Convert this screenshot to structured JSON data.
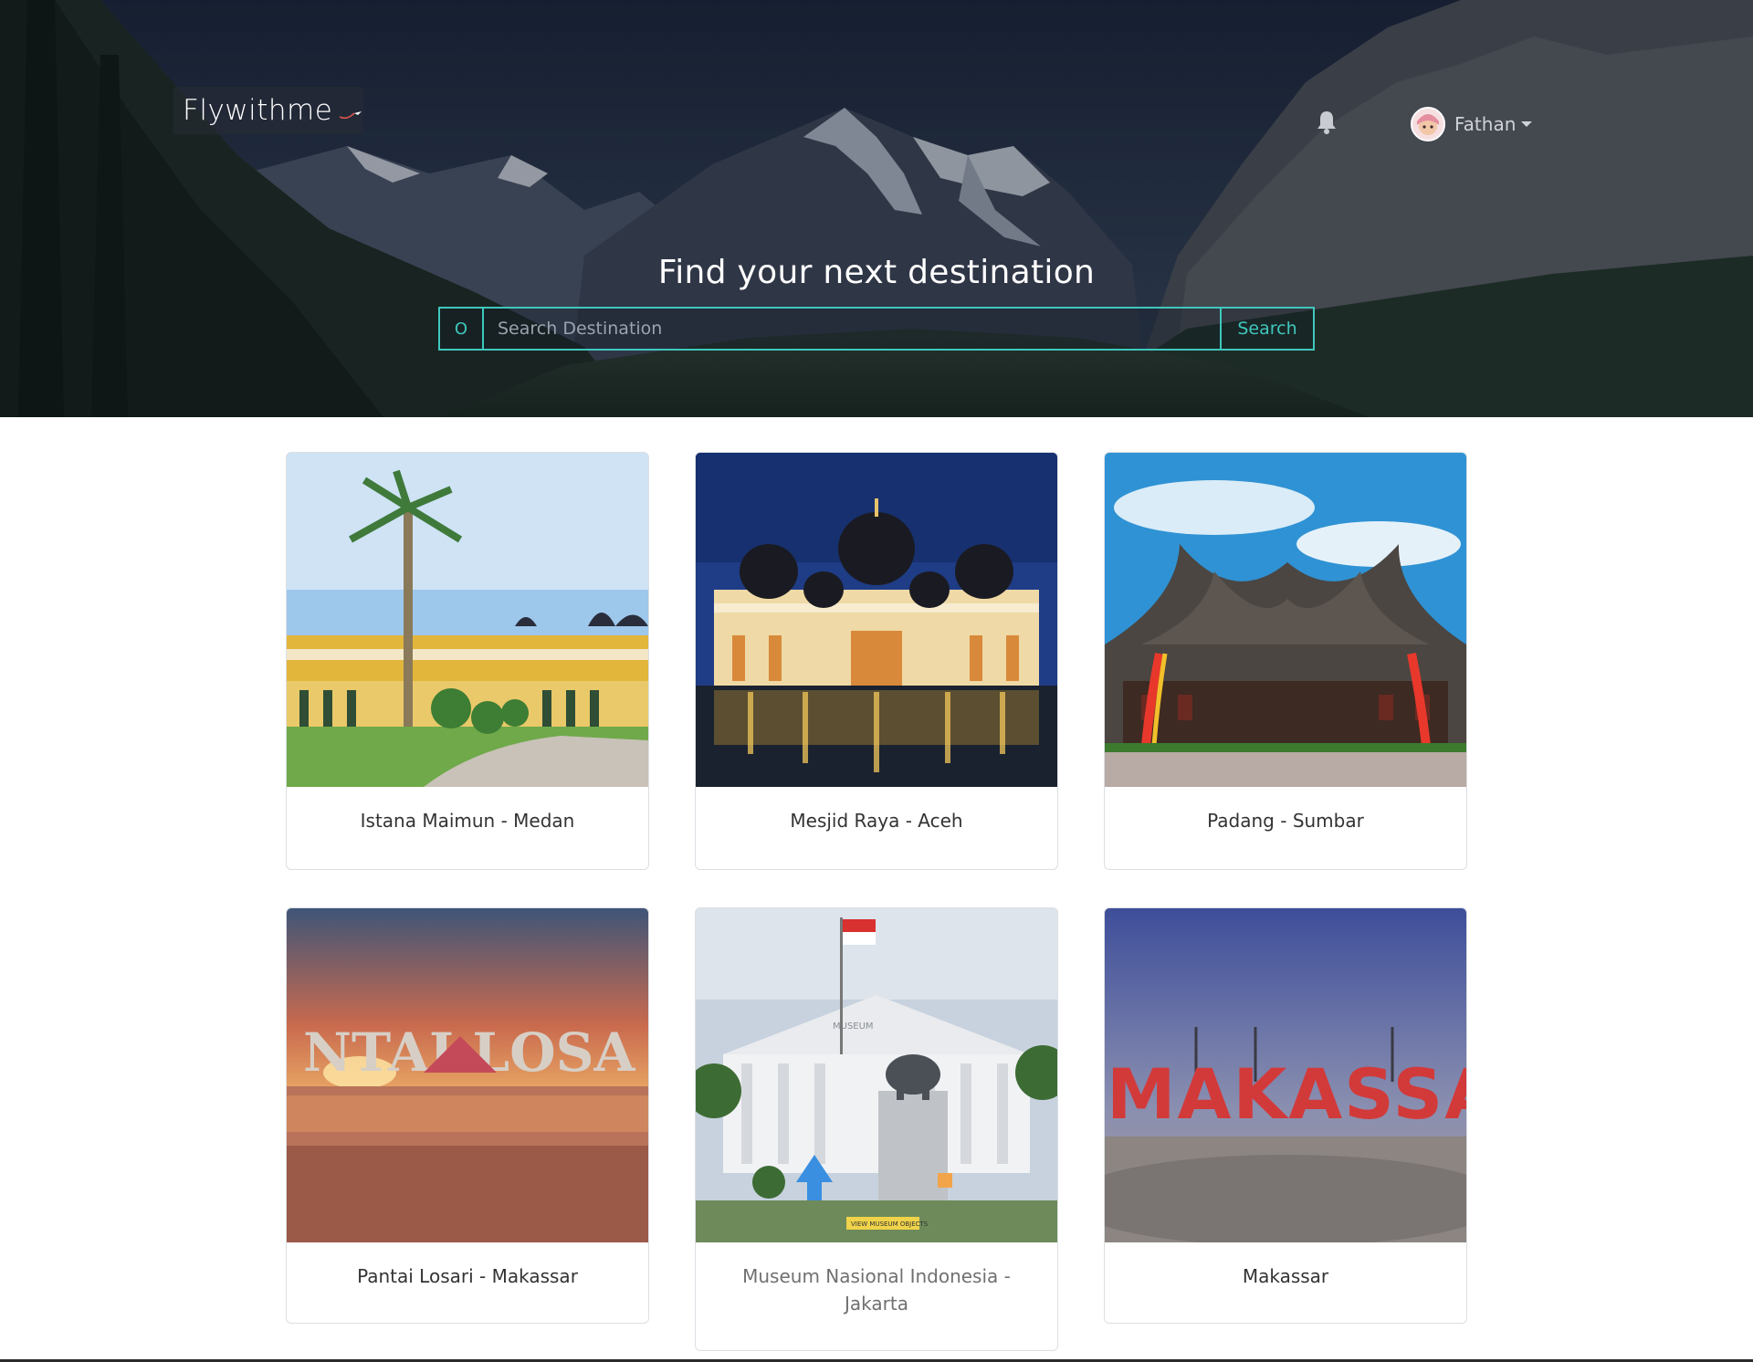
{
  "header": {
    "logo_text": "Flywithme",
    "user_name": "Fathan"
  },
  "hero": {
    "headline": "Find your next destination",
    "search": {
      "placeholder": "Search Destination",
      "icon_glyph": "O",
      "button_label": "Search"
    }
  },
  "icons": {
    "bell": "bell-icon",
    "search": "search-icon",
    "caret": "chevron-down-icon",
    "plane": "plane-icon"
  },
  "colors": {
    "accent": "#3fc7bd",
    "card_border": "#dcdfe3",
    "text": "#333333"
  },
  "destinations": [
    {
      "caption": "Istana Maimun - Medan"
    },
    {
      "caption": "Mesjid Raya - Aceh"
    },
    {
      "caption": "Padang - Sumbar"
    },
    {
      "caption": "Pantai Losari - Makassar"
    },
    {
      "caption": "Museum Nasional Indonesia - Jakarta"
    },
    {
      "caption": "Makassar"
    }
  ],
  "photo_text": {
    "losari_sign": "NTAI LOSA",
    "makassar_sign": "MAKASSA",
    "museum_sign": "VIEW MUSEUM OBJECTS",
    "museum_facade": "MUSEUM"
  }
}
